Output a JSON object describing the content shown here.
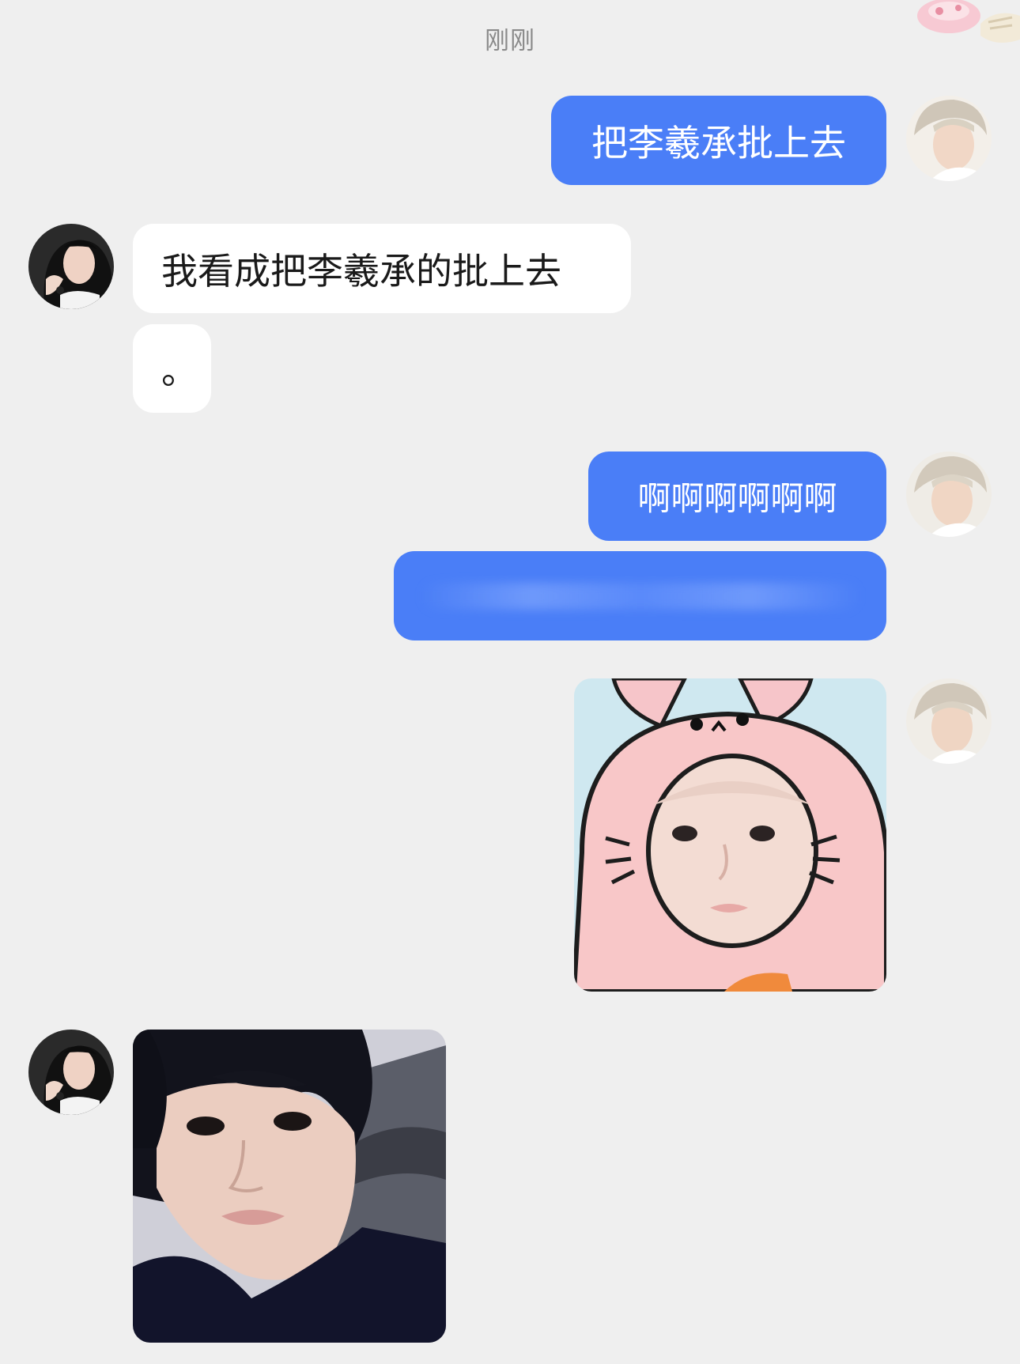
{
  "timestamp": "刚刚",
  "messages": [
    {
      "id": "m1",
      "side": "out",
      "type": "text",
      "text": "把李羲承批上去"
    },
    {
      "id": "m2",
      "side": "in",
      "type": "text",
      "text": "我看成把李羲承的批上去"
    },
    {
      "id": "m3",
      "side": "in",
      "type": "text",
      "text": "。"
    },
    {
      "id": "m4",
      "side": "out",
      "type": "text",
      "text": "啊啊啊啊啊啊"
    },
    {
      "id": "m5",
      "side": "out",
      "type": "text",
      "text": ""
    },
    {
      "id": "m6",
      "side": "out",
      "type": "image",
      "description_icon": "bunny-hood-photo"
    },
    {
      "id": "m7",
      "side": "in",
      "type": "image",
      "description_icon": "portrait-photo"
    }
  ],
  "colors": {
    "background": "#efefef",
    "outgoing_bubble": "#4a7ef7",
    "incoming_bubble": "#ffffff",
    "timestamp_text": "#8a8a8a"
  },
  "icons": {
    "self_avatar": "self-avatar-icon",
    "contact_avatar": "contact-avatar-icon",
    "corner_sticker": "corner-sticker-icon"
  }
}
